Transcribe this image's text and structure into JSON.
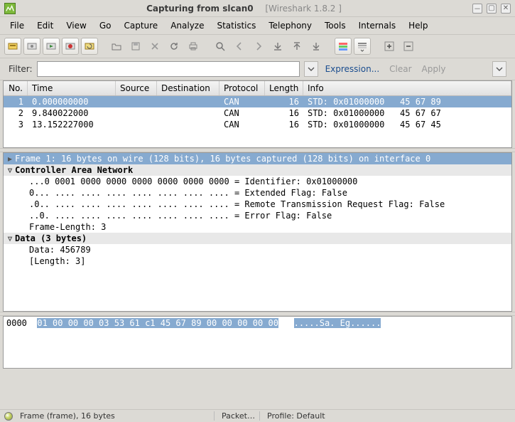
{
  "window": {
    "title_main": "Capturing from slcan0",
    "title_sub": "[Wireshark 1.8.2 ]"
  },
  "menu": [
    "File",
    "Edit",
    "View",
    "Go",
    "Capture",
    "Analyze",
    "Statistics",
    "Telephony",
    "Tools",
    "Internals",
    "Help"
  ],
  "filter": {
    "label": "Filter:",
    "value": "",
    "expression": "Expression...",
    "clear": "Clear",
    "apply": "Apply"
  },
  "columns": {
    "no": "No.",
    "time": "Time",
    "src": "Source",
    "dst": "Destination",
    "proto": "Protocol",
    "len": "Length",
    "info": "Info"
  },
  "packets": [
    {
      "no": "1",
      "time": "0.000000000",
      "src": "",
      "dst": "",
      "proto": "CAN",
      "len": "16",
      "info": "STD: 0x01000000   45 67 89",
      "selected": true
    },
    {
      "no": "2",
      "time": "9.840022000",
      "src": "",
      "dst": "",
      "proto": "CAN",
      "len": "16",
      "info": "STD: 0x01000000   45 67 67",
      "selected": false
    },
    {
      "no": "3",
      "time": "13.152227000",
      "src": "",
      "dst": "",
      "proto": "CAN",
      "len": "16",
      "info": "STD: 0x01000000   45 67 45",
      "selected": false
    }
  ],
  "detail": {
    "frame_line": "Frame 1: 16 bytes on wire (128 bits), 16 bytes captured (128 bits) on interface 0",
    "can_header": "Controller Area Network",
    "can_lines": [
      "...0 0001 0000 0000 0000 0000 0000 0000 = Identifier: 0x01000000",
      "0... .... .... .... .... .... .... .... = Extended Flag: False",
      ".0.. .... .... .... .... .... .... .... = Remote Transmission Request Flag: False",
      "..0. .... .... .... .... .... .... .... = Error Flag: False",
      "Frame-Length: 3"
    ],
    "data_header": "Data (3 bytes)",
    "data_lines": [
      "Data: 456789",
      "[Length: 3]"
    ]
  },
  "hex": {
    "offset": "0000",
    "bytes": "01 00 00 00 03 53 61 c1  45 67 89 00 00 00 00 00",
    "ascii": ".....Sa. Eg......"
  },
  "status": {
    "frame": "Frame (frame), 16 bytes",
    "packets": "Packet…",
    "profile": "Profile: Default"
  }
}
